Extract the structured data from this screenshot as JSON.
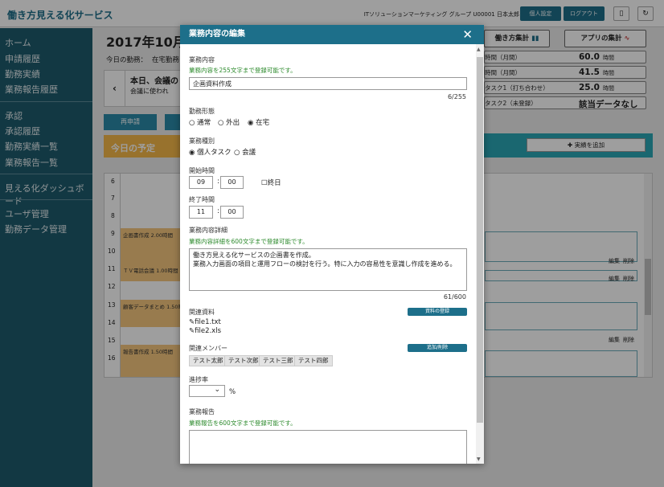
{
  "header": {
    "app_title": "働き方見える化サービス",
    "org": "ITソリューションマーケティング グループ U00001 日本太郎",
    "btn_personal": "個人設定",
    "btn_logout": "ログアウト"
  },
  "sidebar": {
    "items": [
      "ホーム",
      "申請履歴",
      "勤務実績",
      "業務報告履歴",
      "承認",
      "承認履歴",
      "勤務実績一覧",
      "業務報告一覧",
      "見える化ダッシュボード",
      "ユーザ管理",
      "勤務データ管理"
    ]
  },
  "bg": {
    "date": "2017年10月1",
    "today_label": "今日の勤務：",
    "today_value": "在宅勤務",
    "banner_title": "本日、会議の",
    "banner_sub": "会議に使われ",
    "btn_reapply": "再申請",
    "today_plan": "今日の予定",
    "btn_workstyle": "働き方集計",
    "btn_app": "アプリの集計",
    "add_result": "実績を追加",
    "stats": [
      {
        "label": "時間（月間）",
        "value": "60.0",
        "unit": "時間"
      },
      {
        "label": "時間（月間）",
        "value": "41.5",
        "unit": "時間"
      },
      {
        "label": "タスク1（打ち合わせ）",
        "value": "25.0",
        "unit": "時間"
      },
      {
        "label": "タスク2（未登録）",
        "value": "該当データなし",
        "unit": ""
      }
    ],
    "hours": [
      "6",
      "7",
      "8",
      "9",
      "10",
      "11",
      "12",
      "13",
      "14",
      "15",
      "16"
    ],
    "events": [
      "企画書作成 2.00時間",
      "ＴＶ電話会議 1.00時間",
      "顧客データまとめ 1.50時間",
      "報告書作成 1.50時間"
    ],
    "edit_links": [
      "編集",
      "削除"
    ]
  },
  "modal": {
    "title": "業務内容の編集",
    "content_label": "業務内容",
    "content_hint": "業務内容を255文字まで登録可能です。",
    "content_value": "企画資料作成",
    "content_count": "6/255",
    "work_form_label": "勤務形態",
    "work_forms": [
      "通常",
      "外出",
      "在宅"
    ],
    "work_form_selected": "在宅",
    "work_type_label": "業務種別",
    "work_types": [
      "個人タスク",
      "会議"
    ],
    "work_type_selected": "個人タスク",
    "start_label": "開始時間",
    "start_h": "09",
    "start_m": "00",
    "allday": "終日",
    "colon": ":",
    "end_label": "終了時間",
    "end_h": "11",
    "end_m": "00",
    "detail_label": "業務内容詳細",
    "detail_hint": "業務内容詳細を600文字まで登録可能です。",
    "detail_line1": "働き方見える化サービスの企画書を作成。",
    "detail_line2": "業務入力画面の項目と運用フローの検討を行う。特に入力の容易性を意識し作成を進める。",
    "detail_count": "61/600",
    "files_label": "関連資料",
    "files_btn": "資料の登録",
    "files": [
      "file1.txt",
      "file2.xls"
    ],
    "members_label": "関連メンバー",
    "members_btn": "追加/削除",
    "members": [
      "テスト太郎",
      "テスト次郎",
      "テスト三郎",
      "テスト四郎"
    ],
    "progress_label": "進捗率",
    "progress_unit": "%",
    "report_label": "業務報告",
    "report_hint": "業務報告を600文字まで登録可能です。"
  },
  "colors": {
    "accent": "#1d6f8a",
    "sidebar": "#1e5b6d",
    "hint": "#2e8b2e",
    "event": "#f5c77e"
  }
}
